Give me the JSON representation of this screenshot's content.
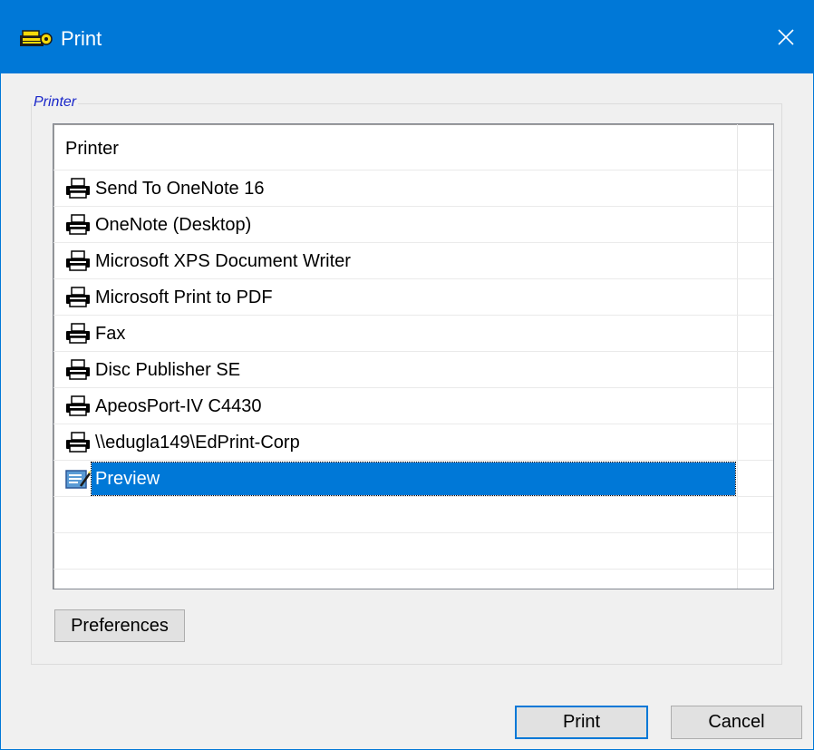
{
  "window": {
    "title": "Print",
    "icon": "printer-app-icon",
    "close_icon": "close-icon",
    "titlebar_color": "#0078d7"
  },
  "printer_group": {
    "legend": "Printer",
    "legend_color": "#1a27c9",
    "column_header": "Printer",
    "items": [
      {
        "label": "Send To OneNote 16",
        "icon": "printer-icon"
      },
      {
        "label": "OneNote (Desktop)",
        "icon": "printer-icon"
      },
      {
        "label": "Microsoft XPS Document Writer",
        "icon": "printer-icon"
      },
      {
        "label": "Microsoft Print to PDF",
        "icon": "printer-icon"
      },
      {
        "label": "Fax",
        "icon": "printer-icon"
      },
      {
        "label": "Disc Publisher SE",
        "icon": "printer-icon"
      },
      {
        "label": "ApeosPort-IV C4430",
        "icon": "printer-icon"
      },
      {
        "label": "\\\\edugla149\\EdPrint-Corp",
        "icon": "printer-icon"
      },
      {
        "label": "Preview",
        "icon": "preview-icon",
        "selected": true
      }
    ],
    "selection_color": "#0078d7",
    "preferences_label": "Preferences"
  },
  "footer": {
    "print_label": "Print",
    "cancel_label": "Cancel"
  }
}
